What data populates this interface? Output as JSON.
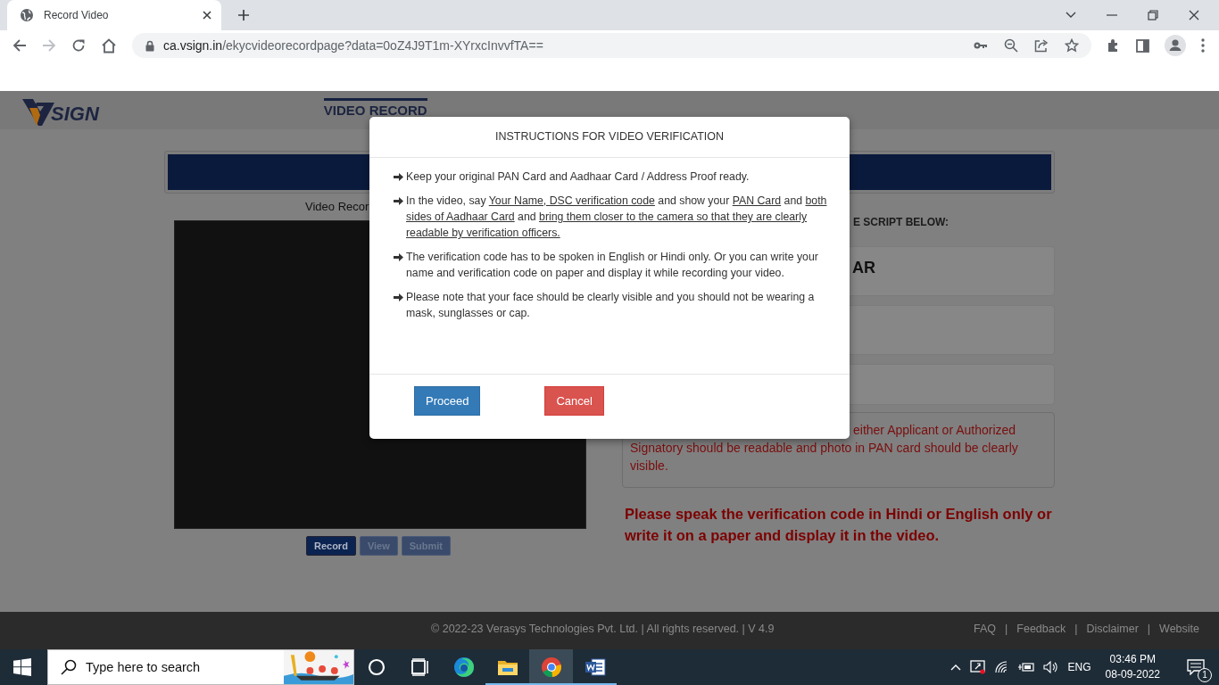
{
  "browser": {
    "tab": {
      "title": "Record Video",
      "selected": true
    },
    "url": {
      "host": "ca.vsign.in",
      "path": "/ekycvideorecordpage?data=0oZ4J9T1m-XYrxcInvvfTA=="
    },
    "forward_disabled": true
  },
  "site": {
    "logo": "SIGN",
    "nav": [
      {
        "label": "VIDEO RECORD",
        "selected": true
      }
    ],
    "video_label": "Video Recor",
    "video_buttons": [
      {
        "label": "Record",
        "disabled": false
      },
      {
        "label": "View",
        "disabled": true
      },
      {
        "label": "Submit",
        "disabled": true
      }
    ],
    "script_heading": "E SCRIPT BELOW:",
    "script_boxes": [
      {
        "kind": "text",
        "text": "AR"
      },
      {
        "kind": "blank"
      },
      {
        "kind": "blank"
      }
    ],
    "note": {
      "first_line": "either Applicant or Authorized",
      "rest": "Signatory should be readable and photo in PAN card should be clearly visible."
    },
    "warning": "Please speak the verification code in Hindi or English only or write it on a paper and display it in the video."
  },
  "modal": {
    "title": "INSTRUCTIONS FOR VIDEO VERIFICATION",
    "instructions": [
      [
        {
          "text": "Keep your original PAN Card and Aadhaar Card / Address Proof ready.",
          "underlined": false
        }
      ],
      [
        {
          "text": "In the video, say ",
          "underlined": false
        },
        {
          "text": "Your Name, DSC verification code",
          "underlined": true
        },
        {
          "text": " and show your ",
          "underlined": false
        },
        {
          "text": "PAN Card",
          "underlined": true
        },
        {
          "text": " and ",
          "underlined": false
        },
        {
          "text": "both sides of Aadhaar Card",
          "underlined": true
        },
        {
          "text": " and ",
          "underlined": false
        },
        {
          "text": "bring them closer to the camera so that they are clearly readable by verification officers.",
          "underlined": true
        }
      ],
      [
        {
          "text": "The verification code has to be spoken in English or Hindi only. Or you can write your name and verification code on paper and display it while recording your video.",
          "underlined": false
        }
      ],
      [
        {
          "text": "Please note that your face should be clearly visible and you should not be wearing a mask, sunglasses or cap.",
          "underlined": false
        }
      ]
    ],
    "buttons": [
      {
        "label": "Proceed",
        "kind": "primary"
      },
      {
        "label": "Cancel",
        "kind": "danger"
      }
    ]
  },
  "footer": {
    "copyright": "©  2022-23  Verasys Technologies Pvt. Ltd. | All rights reserved. | V 4.9",
    "links": [
      "FAQ",
      "Feedback",
      "Disclaimer",
      "Website"
    ],
    "separator": "|"
  },
  "taskbar": {
    "search_placeholder": "Type here to search",
    "apps": [
      {
        "kind": "cortana",
        "selected": false,
        "running": false
      },
      {
        "kind": "taskview",
        "selected": false,
        "running": false
      },
      {
        "kind": "edge",
        "selected": false,
        "running": false
      },
      {
        "kind": "explorer",
        "selected": false,
        "running": true
      },
      {
        "kind": "chrome",
        "selected": true,
        "running": true
      },
      {
        "kind": "word",
        "selected": false,
        "running": true
      }
    ],
    "language": "ENG",
    "time": "03:46 PM",
    "date": "08-09-2022",
    "notification_count": "1"
  }
}
